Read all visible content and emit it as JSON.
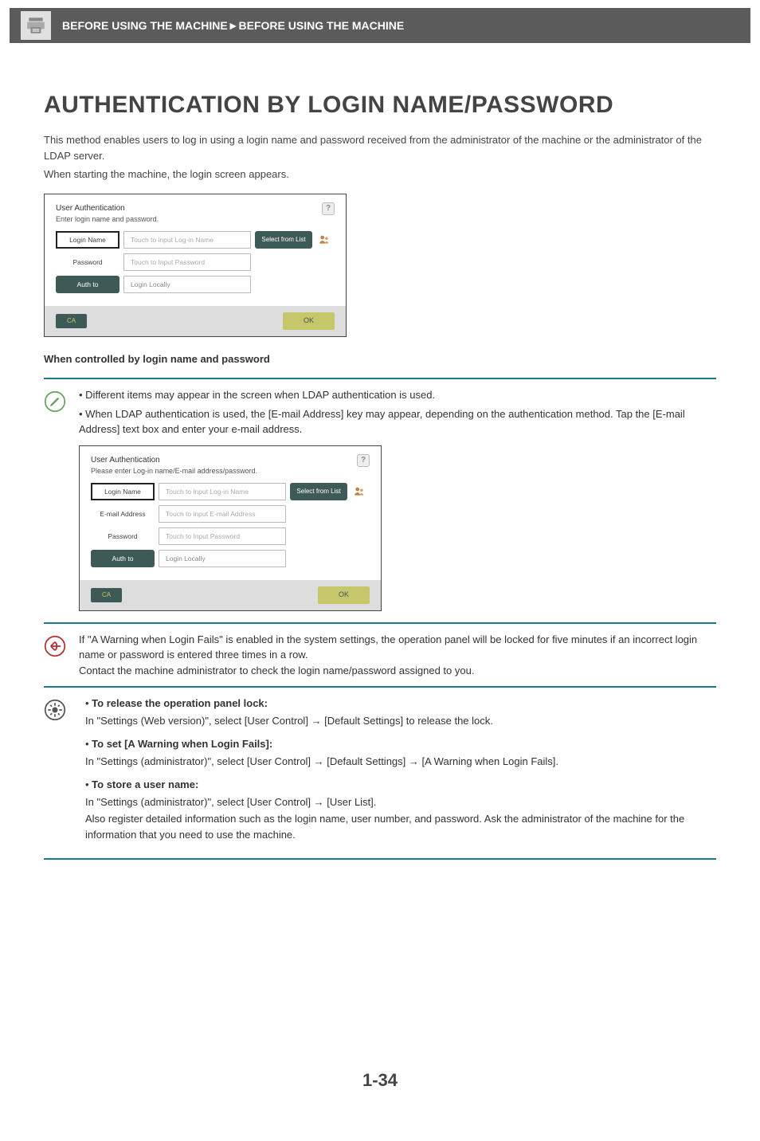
{
  "header": {
    "breadcrumb_prefix": "BEFORE USING THE MACHINE",
    "breadcrumb_sep": "►",
    "breadcrumb_suffix": "BEFORE USING THE MACHINE"
  },
  "title": "AUTHENTICATION BY LOGIN NAME/PASSWORD",
  "intro": [
    "This method enables users to log in using a login name and password received from the administrator of the machine or the administrator of the LDAP server.",
    "When starting the machine, the login screen appears."
  ],
  "panel1": {
    "title": "User Authentication",
    "subtitle": "Enter login name and password.",
    "help": "?",
    "rows": {
      "login_name": {
        "label": "Login Name",
        "placeholder": "Touch to input Log-in Name"
      },
      "password": {
        "label": "Password",
        "placeholder": "Touch to Input Password"
      },
      "auth_to": {
        "label": "Auth to",
        "value": "Login Locally"
      }
    },
    "select_from_list": "Select from List",
    "ca": "CA",
    "ok": "OK"
  },
  "sub_caption": "When controlled by login name and password",
  "callout_note": {
    "bullets": [
      "Different items may appear in the screen when LDAP authentication is used.",
      "When LDAP authentication is used, the [E-mail Address] key may appear, depending on the authentication method. Tap the [E-mail Address] text box and enter your e-mail address."
    ]
  },
  "panel2": {
    "title": "User Authentication",
    "subtitle": "Please enter Log-in name/E-mail address/password.",
    "help": "?",
    "rows": {
      "login_name": {
        "label": "Login Name",
        "placeholder": "Touch to input Log-in Name"
      },
      "email": {
        "label": "E-mail Address",
        "placeholder": "Touch to input E-mail Address"
      },
      "password": {
        "label": "Password",
        "placeholder": "Touch to Input Password"
      },
      "auth_to": {
        "label": "Auth to",
        "value": "Login Locally"
      }
    },
    "select_from_list": "Select from List",
    "ca": "CA",
    "ok": "OK"
  },
  "callout_warn": {
    "para": "If \"A Warning when Login Fails\" is enabled in the system settings, the operation panel will be locked for five minutes if an incorrect login name or password is entered three times in a row.",
    "para2": "Contact the machine administrator to check the login name/password assigned to you."
  },
  "callout_settings": {
    "items": [
      {
        "head": "To release the operation panel lock:",
        "body": "In \"Settings (Web version)\", select [User Control] → [Default Settings] to release the lock."
      },
      {
        "head": "To set [A Warning when Login Fails]:",
        "body": "In \"Settings (administrator)\", select [User Control] → [Default Settings] → [A Warning when Login Fails]."
      },
      {
        "head": "To store a user name:",
        "body": "In \"Settings (administrator)\", select [User Control] → [User List].",
        "body2": "Also register detailed information such as the login name, user number, and password. Ask the administrator of the machine for the information that you need to use the machine."
      }
    ]
  },
  "page_number": "1-34"
}
